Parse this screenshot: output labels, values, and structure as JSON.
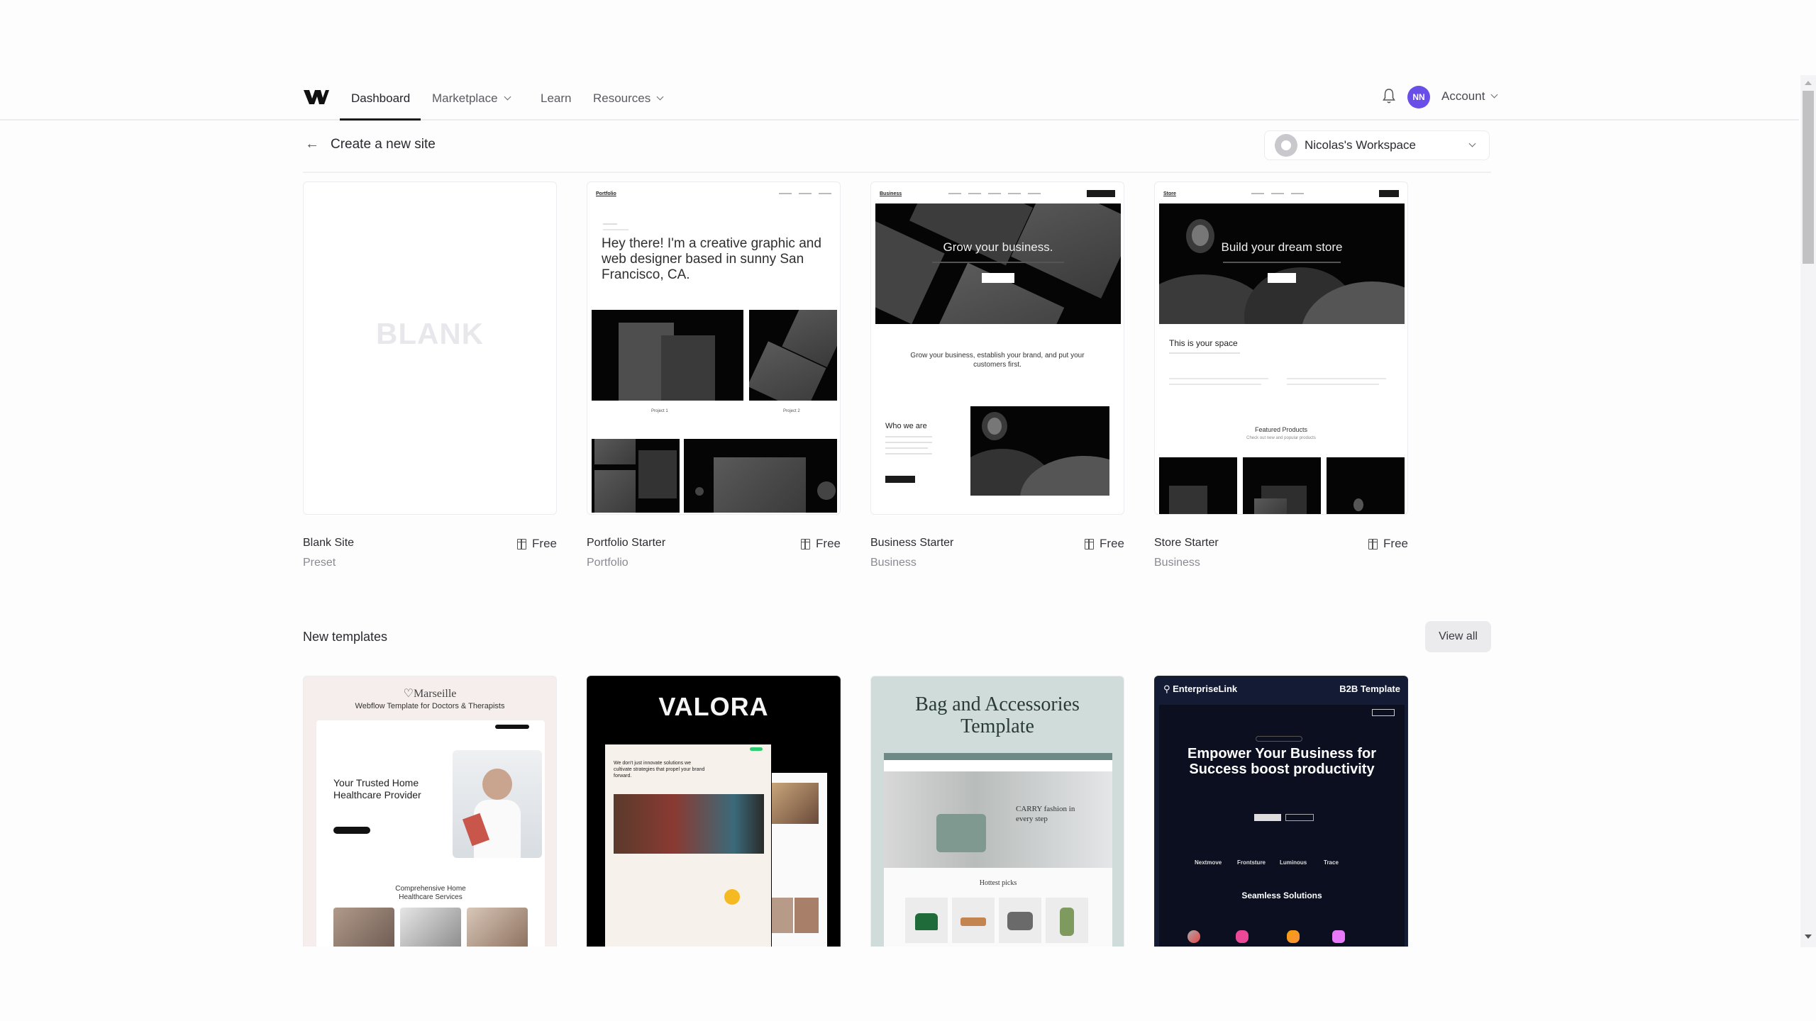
{
  "nav": {
    "logo": "webflow-logo",
    "items": [
      {
        "label": "Dashboard",
        "active": true,
        "has_dropdown": false
      },
      {
        "label": "Marketplace",
        "active": false,
        "has_dropdown": true
      },
      {
        "label": "Learn",
        "active": false,
        "has_dropdown": false
      },
      {
        "label": "Resources",
        "active": false,
        "has_dropdown": true
      }
    ],
    "notifications_icon": "bell-icon",
    "avatar_initials": "NN",
    "avatar_color": "#6a4ee8",
    "account_label": "Account"
  },
  "header": {
    "back_icon": "arrow-left-icon",
    "title": "Create a new site",
    "workspace": "Nicolas's Workspace"
  },
  "starters": [
    {
      "title": "Blank Site",
      "subtitle": "Preset",
      "price": "Free",
      "preview_label": "BLANK"
    },
    {
      "title": "Portfolio Starter",
      "subtitle": "Portfolio",
      "price": "Free",
      "preview": {
        "brand": "Portfolio",
        "headline": "Hey there! I'm a creative graphic and web designer based in sunny San Francisco, CA.",
        "project1": "Project 1",
        "project2": "Project 2"
      }
    },
    {
      "title": "Business Starter",
      "subtitle": "Business",
      "price": "Free",
      "preview": {
        "brand": "Business",
        "hero": "Grow your business.",
        "tagline": "Grow your business, establish your brand, and put your customers first.",
        "section": "Who we are"
      }
    },
    {
      "title": "Store Starter",
      "subtitle": "Business",
      "price": "Free",
      "preview": {
        "brand": "Store",
        "hero": "Build your dream store",
        "section": "This is your space",
        "featured": "Featured Products",
        "featured_sub": "Check out new and popular products"
      }
    }
  ],
  "new_templates": {
    "title": "New templates",
    "view_all_label": "View all",
    "items": [
      {
        "name": "Marseille",
        "tagline": "Webflow Template for Doctors & Therapists",
        "hero": "Your Trusted Home Healthcare Provider",
        "section": "Comprehensive Home Healthcare Services",
        "bg": "#f5eeec"
      },
      {
        "name": "VALORA",
        "hero": "We don't just innovate solutions we cultivate strategies that propel your brand forward.",
        "bg": "#000000"
      },
      {
        "name": "Bag and Accessories Template",
        "hero": "CARRY fashion in every step",
        "section": "Hottest picks",
        "bg": "#cfdcda"
      },
      {
        "name": "EnterpriseLink",
        "badge": "B2B Template",
        "hero": "Empower Your Business for Success boost productivity",
        "logos": [
          "Nextmove",
          "Frontsture",
          "Luminous",
          "Trace"
        ],
        "section": "Seamless Solutions",
        "bg": "#131a33"
      }
    ]
  }
}
